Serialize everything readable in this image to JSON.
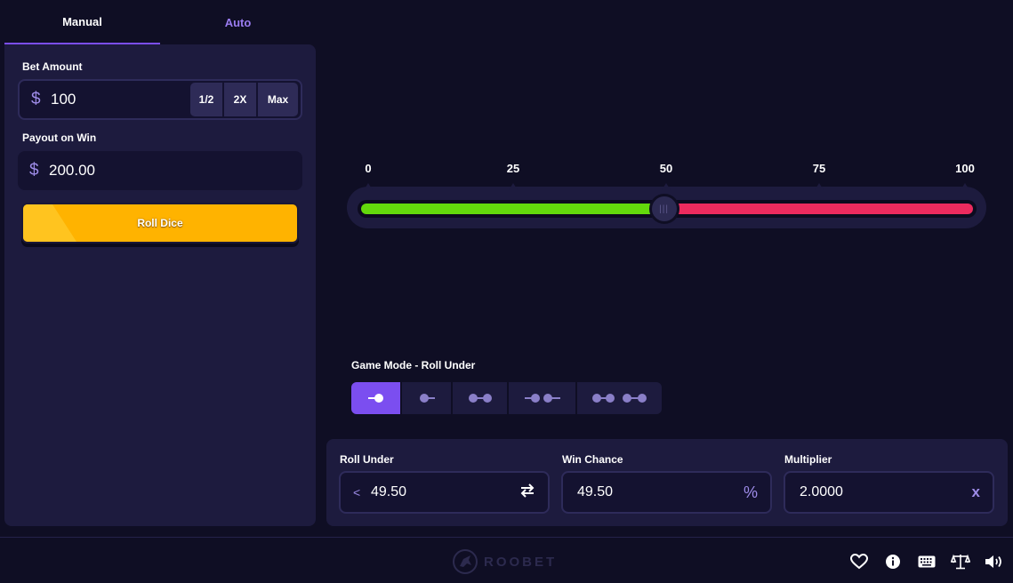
{
  "tabs": [
    {
      "label": "Manual",
      "active": true
    },
    {
      "label": "Auto",
      "active": false
    }
  ],
  "bet": {
    "label": "Bet Amount",
    "currency_symbol": "$",
    "value": "100",
    "half_label": "1/2",
    "double_label": "2X",
    "max_label": "Max"
  },
  "payout": {
    "label": "Payout on Win",
    "currency_symbol": "$",
    "value": "200.00"
  },
  "roll_button_label": "Roll Dice",
  "slider": {
    "ticks": [
      "0",
      "25",
      "50",
      "75",
      "100"
    ],
    "min": 0,
    "max": 100,
    "value": 49.5,
    "win_color": "#63d90c",
    "lose_color": "#ec2b5e"
  },
  "game_mode": {
    "label": "Game Mode - Roll Under",
    "modes": [
      "roll-under",
      "roll-over",
      "between",
      "outside",
      "between-sets"
    ],
    "active_index": 0
  },
  "stats": {
    "roll_under": {
      "label": "Roll Under",
      "prefix": "<",
      "value": "49.50"
    },
    "win_chance": {
      "label": "Win Chance",
      "value": "49.50",
      "suffix": "%"
    },
    "multiplier": {
      "label": "Multiplier",
      "value": "2.0000",
      "suffix": "x"
    }
  },
  "footer": {
    "logo_text": "ROOBET",
    "icons": [
      "heart-icon",
      "info-icon",
      "keyboard-icon",
      "balance-scale-icon",
      "volume-icon"
    ]
  },
  "colors": {
    "accent": "#7b4ef0",
    "button_yellow": "#ffb300",
    "panel": "#1d1b3e",
    "background": "#0f0e24"
  }
}
